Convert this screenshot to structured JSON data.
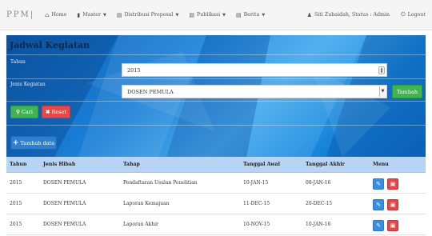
{
  "navbar": {
    "brand": "PPM|",
    "items": [
      {
        "icon": "home-icon",
        "glyph": "⌂",
        "label": "Home",
        "caret": false
      },
      {
        "icon": "file-icon",
        "glyph": "▮",
        "label": "Master",
        "caret": true
      },
      {
        "icon": "list-icon",
        "glyph": "▤",
        "label": "Distribusi Proposal",
        "caret": true
      },
      {
        "icon": "list-icon",
        "glyph": "▤",
        "label": "Publikasi",
        "caret": true
      },
      {
        "icon": "list-icon",
        "glyph": "▤",
        "label": "Berita",
        "caret": true
      }
    ],
    "user_label": "Siti Zubaidah, Status : Admin",
    "logout_label": "Logout"
  },
  "panel": {
    "title": "Jadwal Kegiatan",
    "tahun_label": "Tahun",
    "tahun_value": "2015",
    "jenis_label": "Jenis Kegiatan",
    "jenis_value": "DOSEN PEMULA",
    "tambah_label": "Tambah",
    "cari_label": "Cari",
    "reset_label": "Reset",
    "tambah_data_label": "Tambah data"
  },
  "table": {
    "headers": [
      "Tahun",
      "Jenis Hibah",
      "Tahap",
      "Tanggal Awal",
      "Tanggal Akhir",
      "Menu"
    ],
    "rows": [
      [
        "2015",
        "DOSEN PEMULA",
        "Pendaftaran Usulan Penelitian",
        "10-JAN-15",
        "08-JAN-16"
      ],
      [
        "2015",
        "DOSEN PEMULA",
        "Laporan Kemajuan",
        "11-DEC-15",
        "20-DEC-15"
      ],
      [
        "2015",
        "DOSEN PEMULA",
        "Laporan Akhir",
        "10-NOV-15",
        "10-JAN-16"
      ]
    ]
  },
  "colors": {
    "panel_blue": "#1a7fd6",
    "success": "#3fb450",
    "danger": "#e04b4b",
    "primary": "#2f7fd1",
    "table_header": "#b7d4f4"
  }
}
